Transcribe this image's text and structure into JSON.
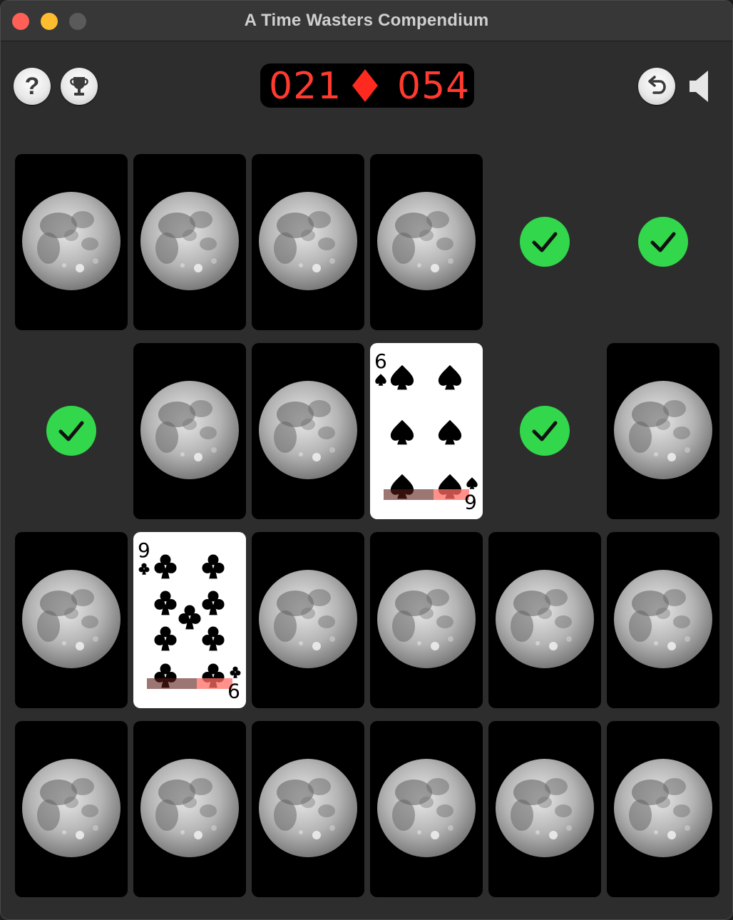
{
  "window": {
    "title": "A Time Wasters Compendium"
  },
  "toolbar": {
    "help_label": "?",
    "help_icon": "help-icon",
    "trophy_icon": "trophy-icon",
    "undo_icon": "undo-icon",
    "sound_icon": "speaker-icon"
  },
  "scoreboard": {
    "left_value": "021",
    "right_value": "054",
    "separator_icon": "diamond-icon",
    "color": "#ff3b30"
  },
  "colors": {
    "check": "#32d74b",
    "card_back": "#000000",
    "window_bg": "#2d2d2d"
  },
  "board": {
    "rows": [
      [
        "back",
        "back",
        "back",
        "back",
        "matched",
        "matched"
      ],
      [
        "matched",
        "back",
        "back",
        "face",
        "matched",
        "back"
      ],
      [
        "back",
        "face",
        "back",
        "back",
        "back",
        "back"
      ],
      [
        "back",
        "back",
        "back",
        "back",
        "back",
        "back"
      ]
    ],
    "faces": [
      {
        "row": 1,
        "col": 3,
        "rank": "6",
        "suit": "spades",
        "suit_symbol": "♠"
      },
      {
        "row": 2,
        "col": 1,
        "rank": "9",
        "suit": "clubs",
        "suit_symbol": "♣"
      }
    ]
  }
}
